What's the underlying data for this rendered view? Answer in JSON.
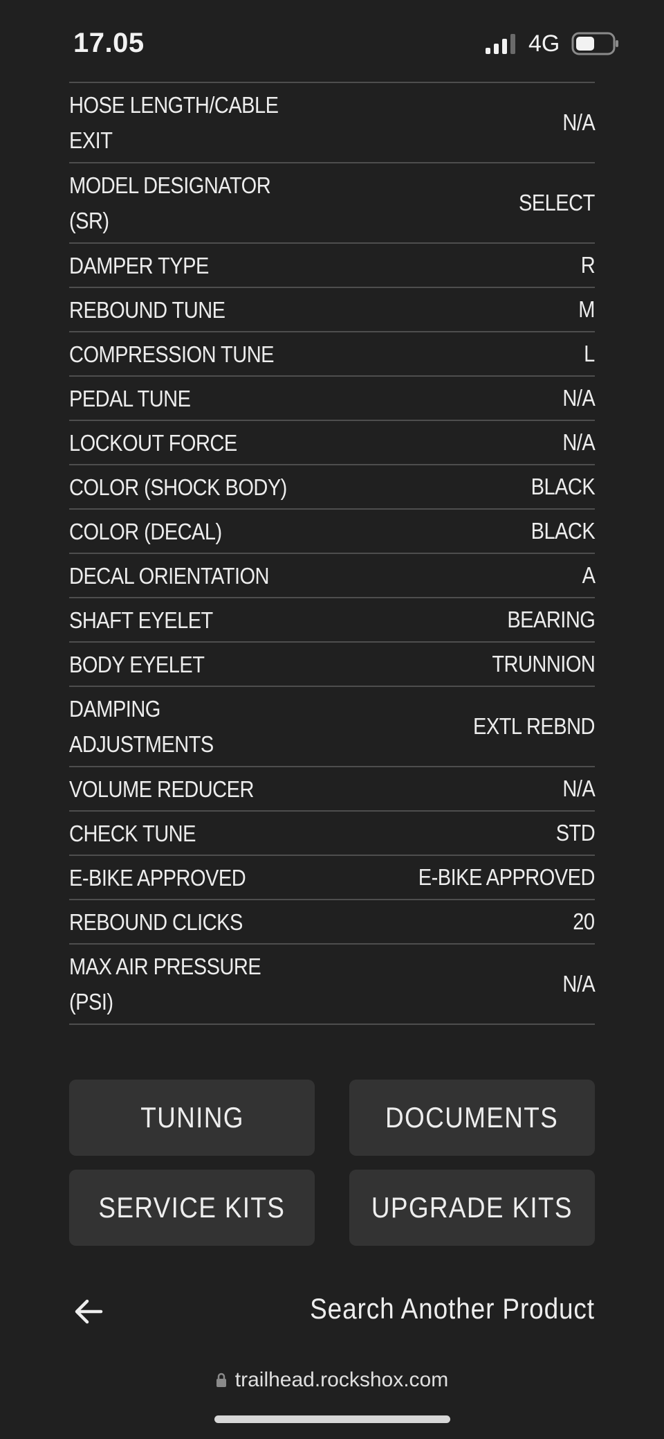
{
  "status_bar": {
    "time": "17.05",
    "network": "4G",
    "icons": [
      "signal-icon",
      "battery-icon"
    ]
  },
  "specs": [
    {
      "label": "HOSE LENGTH/CABLE EXIT",
      "value": "N/A",
      "tall": true
    },
    {
      "label": "MODEL DESIGNATOR (SR)",
      "value": "SELECT",
      "tall": true
    },
    {
      "label": "DAMPER TYPE",
      "value": "R",
      "tall": false
    },
    {
      "label": "REBOUND TUNE",
      "value": "M",
      "tall": false
    },
    {
      "label": "COMPRESSION TUNE",
      "value": "L",
      "tall": false
    },
    {
      "label": "PEDAL TUNE",
      "value": "N/A",
      "tall": false
    },
    {
      "label": "LOCKOUT FORCE",
      "value": "N/A",
      "tall": false
    },
    {
      "label": "COLOR (SHOCK BODY)",
      "value": "BLACK",
      "tall": false
    },
    {
      "label": "COLOR (DECAL)",
      "value": "BLACK",
      "tall": false
    },
    {
      "label": "DECAL ORIENTATION",
      "value": "A",
      "tall": false
    },
    {
      "label": "SHAFT EYELET",
      "value": "BEARING",
      "tall": false
    },
    {
      "label": "BODY EYELET",
      "value": "TRUNNION",
      "tall": false
    },
    {
      "label": "DAMPING ADJUSTMENTS",
      "value": "EXTL REBND",
      "tall": true
    },
    {
      "label": "VOLUME REDUCER",
      "value": "N/A",
      "tall": false
    },
    {
      "label": "CHECK TUNE",
      "value": "STD",
      "tall": false
    },
    {
      "label": "E-BIKE APPROVED",
      "value": "E-BIKE APPROVED",
      "tall": false
    },
    {
      "label": "REBOUND CLICKS",
      "value": "20",
      "tall": false
    },
    {
      "label": "MAX AIR PRESSURE (PSI)",
      "value": "N/A",
      "tall": true
    }
  ],
  "buttons": {
    "tuning": "TUNING",
    "documents": "DOCUMENTS",
    "service_kits": "SERVICE KITS",
    "upgrade_kits": "UPGRADE KITS"
  },
  "footer": {
    "back_icon": "arrow-left-icon",
    "search_link": "Search Another Product"
  },
  "browser": {
    "url": "trailhead.rockshox.com",
    "lock_icon": "lock-icon"
  },
  "colors": {
    "background": "#202020",
    "button": "#333333",
    "divider": "#4e4e4e",
    "text": "#ededed"
  }
}
